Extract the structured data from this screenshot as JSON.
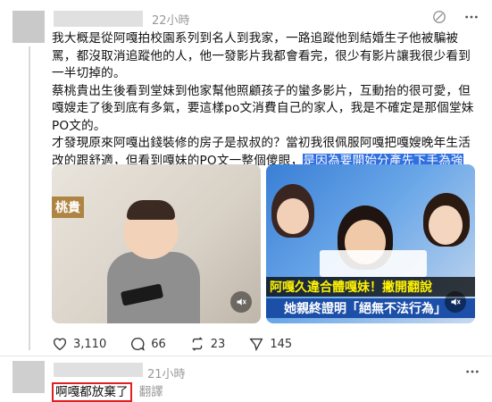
{
  "post": {
    "timestamp": "22小時",
    "paragraph1": "我大概是從阿嘎拍校園系列到名人到我家，一路追蹤他到結婚生子他被騙被罵，都沒取消追蹤他的人，他一發影片我都會看完，很少有影片讓我很少看到一半切掉的。",
    "paragraph2": "蔡桃貴出生後看到堂妹到他家幫他照顧孩子的蠻多影片，互動抬的很可愛，但嘎嫂走了後到底有多氣，要這樣po文消費自己的家人，我是不確定是那個堂妹PO文的。",
    "paragraph3_before": "才發現原來阿嘎出錢裝修的房子是叔叔的？當初我很佩服阿嘎把嘎嫂晚年生活改的跟舒適，但看到嘎妹的PO文一整個傻眼，",
    "paragraph3_highlight": "是因為要開始分產先下手為強嗎",
    "paragraph3_after": "？",
    "translate_label": "翻譯",
    "media": [
      {
        "watermark": "桃貴",
        "mute_icon": "speaker-mute-icon"
      },
      {
        "banner_top": "阿嘎久違合體嘎妹！撇開翻說",
        "banner_bottom": "她親終證明「絕無不法行為」",
        "mute_icon": "speaker-mute-icon"
      }
    ],
    "actions": {
      "likes": "3,110",
      "comments": "66",
      "reposts": "23",
      "shares": "145"
    }
  },
  "reply": {
    "timestamp": "21小時",
    "text": "啊嘎都放棄了",
    "translate_label": "翻譯"
  },
  "colors": {
    "highlight": "#2f6fe0",
    "box_border": "#e02020",
    "muted_text": "#999999"
  }
}
